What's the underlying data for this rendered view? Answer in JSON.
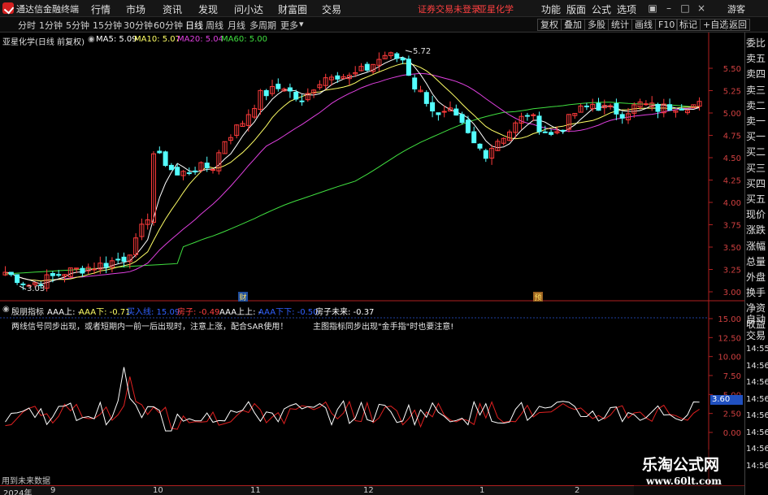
{
  "titlebar": {
    "app_title": "通达信金融终端",
    "menus": [
      "行情",
      "市场",
      "资讯",
      "发现",
      "问小达",
      "财富圈",
      "交易"
    ],
    "login_notice": "证券交易未登录",
    "stock_name": "亚星化学",
    "right_menus": [
      "功能",
      "版面",
      "公式",
      "选项"
    ],
    "guest": "游客"
  },
  "toolbar": {
    "periods": [
      "分时",
      "1分钟",
      "5分钟",
      "15分钟",
      "30分钟",
      "60分钟",
      "日线",
      "周线",
      "月线",
      "多周期",
      "更多"
    ],
    "active_period": "日线",
    "buttons": [
      "复权",
      "叠加",
      "多股",
      "统计",
      "画线",
      "F10",
      "标记",
      "+自选",
      "返回"
    ]
  },
  "main_chart": {
    "stock_label": "亚星化学(日线 前复权)",
    "ma5": "MA5: 5.09",
    "ma10": "MA10: 5.07",
    "ma20": "MA20: 5.04",
    "ma60": "MA60: 5.00",
    "high_label": "5.72",
    "low_label": "3.03",
    "marker_cai": "财",
    "marker_yu": "预",
    "y_ticks": [
      "5.50",
      "5.25",
      "5.00",
      "4.75",
      "4.50",
      "4.25",
      "4.00",
      "3.75",
      "3.50",
      "3.25",
      "3.00"
    ]
  },
  "indicator": {
    "name": "殷朋指标",
    "aaa_up": "AAA上: -",
    "aaa_down": "AAA下: -0.71",
    "buy_line": "买入线: 15.09",
    "house": "房子: -0.49",
    "aaa_up2": "AAA上上: -",
    "aaa_down2": "AAA下下: -0.50",
    "house_future": "房子未来: -0.37",
    "hint1": "两线信号同步出现，或者短期内一前一后出现时，注意上涨，配合SAR使用！",
    "hint2": "主图指标同步出现\"金手指\"时也要注意!",
    "y_ticks": [
      "15.00",
      "12.50",
      "10.00",
      "7.50",
      "5.00",
      "2.50",
      "0.00"
    ],
    "current_value": "3.60",
    "future_label": "用到未来数据"
  },
  "x_axis": {
    "labels": [
      "2024年",
      "9",
      "10",
      "11",
      "12",
      "1",
      "2"
    ]
  },
  "right_column": [
    "委比",
    "卖五",
    "卖四",
    "卖三",
    "卖二",
    "卖一",
    "买一",
    "买二",
    "买三",
    "买四",
    "买五",
    "现价",
    "涨跌",
    "涨幅",
    "总量",
    "外盘",
    "换手",
    "净资",
    "收益",
    "自动",
    "交易",
    "14:55",
    "14:56",
    "14:56",
    "14:56",
    "14:56",
    "14:56",
    "14:56",
    "14:56"
  ],
  "watermark": {
    "line1": "乐淘公式网",
    "line2": "www.60lt.com"
  },
  "colors": {
    "up": "#ff3b3b",
    "down": "#54ffff",
    "ma5": "#ffffff",
    "ma10": "#ffff66",
    "ma20": "#e040e0",
    "ma60": "#40e040",
    "indicator_white": "#ffffff",
    "indicator_red": "#e02020"
  }
}
